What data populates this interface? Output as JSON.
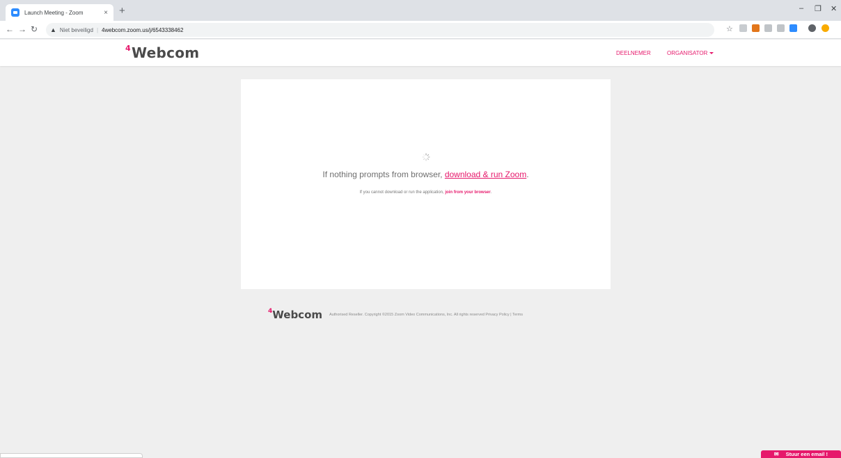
{
  "browser": {
    "tab_title": "Launch Meeting - Zoom",
    "tab_close": "×",
    "new_tab": "+",
    "security_label": "Niet beveiligd",
    "url": "4webcom.zoom.us/j/6543338462",
    "minimize": "–",
    "restore": "❐",
    "close": "✕"
  },
  "header": {
    "logo_sup": "4",
    "logo_text": "Webcom",
    "nav_participant": "DEELNEMER",
    "nav_organizer": "ORGANISATOR"
  },
  "main": {
    "prompt_text": "If nothing prompts from browser, ",
    "prompt_link": "download & run Zoom",
    "prompt_end": ".",
    "sub_text": "If you cannot download or run the application, ",
    "sub_link": "join from your browser",
    "sub_end": "."
  },
  "footer": {
    "logo_sup": "4",
    "logo_text": "Webcom",
    "text": "Authorised Reseller. Copyright ©2015 Zoom Video Communications, Inc. All rights reserved Privacy Policy | Terms"
  },
  "widget": {
    "email_label": "Stuur een email !"
  },
  "colors": {
    "accent": "#e6186b",
    "page_bg": "#efefef"
  }
}
